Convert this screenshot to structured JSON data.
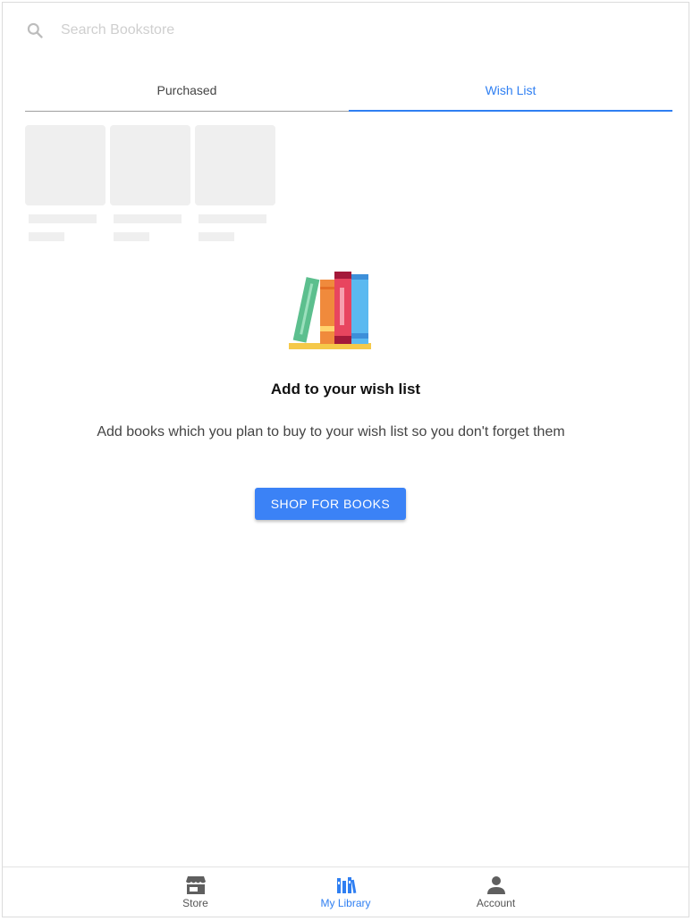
{
  "search": {
    "placeholder": "Search Bookstore",
    "icon": "search-icon"
  },
  "tabs": [
    {
      "label": "Purchased",
      "active": false
    },
    {
      "label": "Wish List",
      "active": true
    }
  ],
  "empty_state": {
    "title": "Add to your wish list",
    "description": "Add books which you plan to buy to your wish list so you don't forget them",
    "button_label": "SHOP FOR BOOKS",
    "illustration": "books-illustration"
  },
  "bottom_nav": [
    {
      "label": "Store",
      "icon": "store-icon",
      "active": false
    },
    {
      "label": "My Library",
      "icon": "library-icon",
      "active": true
    },
    {
      "label": "Account",
      "icon": "account-icon",
      "active": false
    }
  ],
  "colors": {
    "accent": "#2f7ff2",
    "button": "#3b82f6",
    "skeleton": "#efefef"
  }
}
